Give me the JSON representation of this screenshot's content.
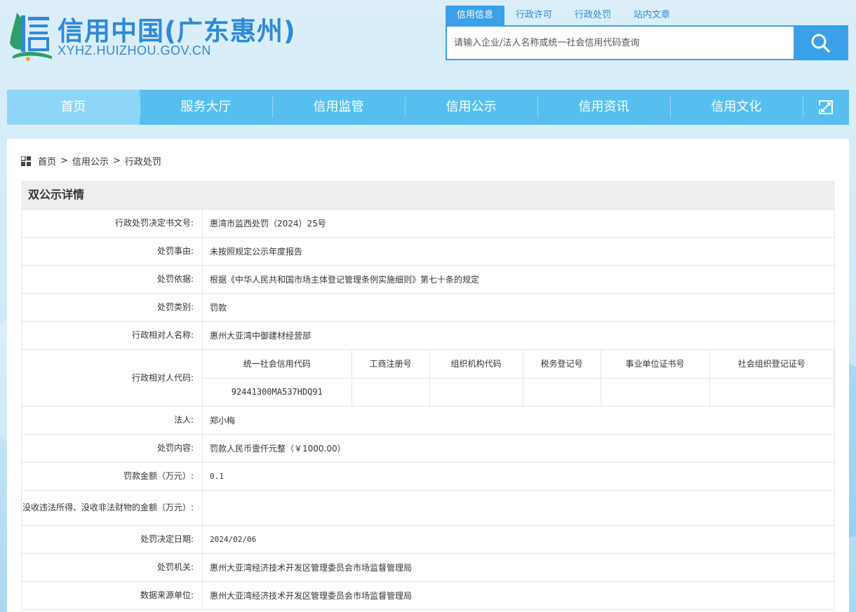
{
  "header": {
    "title": "信用中国(广东惠州)",
    "url": "XYHZ.HUIZHOU.GOV.CN",
    "logo_text": "信"
  },
  "search": {
    "tabs": [
      "信用信息",
      "行政许可",
      "行政处罚",
      "站内文章"
    ],
    "active_tab": 0,
    "placeholder": "请输入企业/法人名称或统一社会信用代码查询",
    "button_icon": "search-icon"
  },
  "nav": {
    "items": [
      "首页",
      "服务大厅",
      "信用监管",
      "信用公示",
      "信用资讯",
      "信用文化"
    ],
    "active": 0,
    "expand_icon": "expand-icon"
  },
  "breadcrumb": {
    "items": [
      "首页",
      "信用公示",
      "行政处罚"
    ],
    "separator": ">"
  },
  "panel": {
    "title": "双公示详情"
  },
  "details": {
    "decision_no": {
      "label": "行政处罚决定书文号:",
      "value": "惠湾市监西处罚（2024）25号"
    },
    "reason": {
      "label": "处罚事由:",
      "value": "未按照规定公示年度报告"
    },
    "basis": {
      "label": "处罚依据:",
      "value": "根据《中华人民共和国市场主体登记管理条例实施细则》第七十条的规定"
    },
    "category": {
      "label": "处罚类别:",
      "value": "罚款"
    },
    "party_name": {
      "label": "行政相对人名称:",
      "value": "惠州大亚湾中御建材经营部"
    },
    "party_code": {
      "label": "行政相对人代码:",
      "headers": [
        "统一社会信用代码",
        "工商注册号",
        "组织机构代码",
        "税务登记号",
        "事业单位证书号",
        "社会组织登记证号"
      ],
      "values": [
        "92441300MA537HDQ91",
        "",
        "",
        "",
        "",
        ""
      ]
    },
    "legal_person": {
      "label": "法人:",
      "value": "郑小梅"
    },
    "content": {
      "label": "处罚内容:",
      "value": "罚款人民币壹仟元整（￥1000.00）"
    },
    "amount": {
      "label": "罚款金额（万元）:",
      "value": "0.1"
    },
    "confiscation": {
      "label": "没收违法所得、没收非法财物的金额（万元）:",
      "value": ""
    },
    "date": {
      "label": "处罚决定日期:",
      "value": "2024/02/06"
    },
    "authority": {
      "label": "处罚机关:",
      "value": "惠州大亚湾经济技术开发区管理委员会市场监督管理局"
    },
    "source": {
      "label": "数据来源单位:",
      "value": "惠州大亚湾经济技术开发区管理委员会市场监督管理局"
    }
  },
  "colors": {
    "brand": "#2e8ad6",
    "nav": "#56bff0",
    "nav_active": "#8dd6f7",
    "search": "#3aa0e8"
  }
}
